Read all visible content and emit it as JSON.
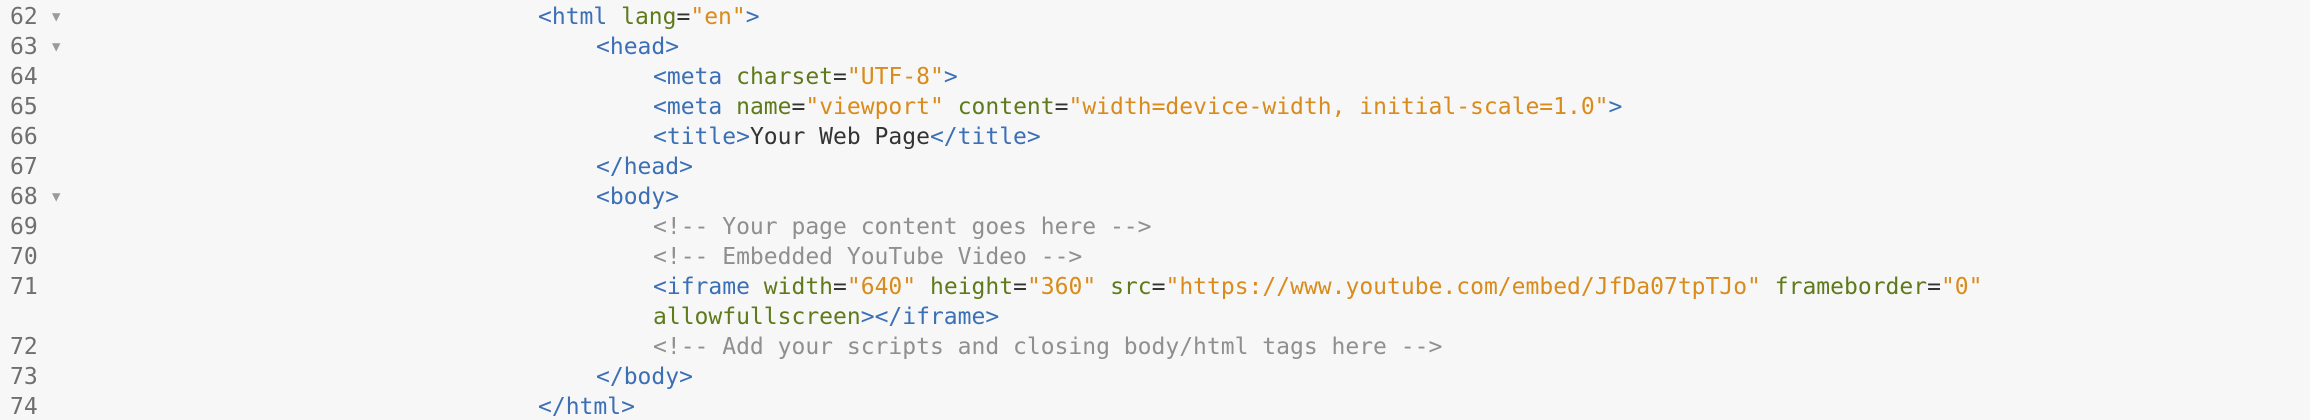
{
  "editor": {
    "lines": [
      {
        "number": "62",
        "fold": "▼",
        "tokens": [
          {
            "text": "<html ",
            "type": "tag"
          },
          {
            "text": "lang",
            "type": "attr"
          },
          {
            "text": "=",
            "type": "txt"
          },
          {
            "text": "\"en\"",
            "type": "str"
          },
          {
            "text": ">",
            "type": "tag"
          }
        ]
      },
      {
        "number": "63",
        "fold": "▼",
        "tokens": [
          {
            "text": "<head>",
            "type": "tag"
          }
        ]
      },
      {
        "number": "64",
        "fold": "",
        "tokens": [
          {
            "text": "<meta ",
            "type": "tag"
          },
          {
            "text": "charset",
            "type": "attr"
          },
          {
            "text": "=",
            "type": "txt"
          },
          {
            "text": "\"UTF-8\"",
            "type": "str"
          },
          {
            "text": ">",
            "type": "tag"
          }
        ]
      },
      {
        "number": "65",
        "fold": "",
        "tokens": [
          {
            "text": "<meta ",
            "type": "tag"
          },
          {
            "text": "name",
            "type": "attr"
          },
          {
            "text": "=",
            "type": "txt"
          },
          {
            "text": "\"viewport\"",
            "type": "str"
          },
          {
            "text": " ",
            "type": "txt"
          },
          {
            "text": "content",
            "type": "attr"
          },
          {
            "text": "=",
            "type": "txt"
          },
          {
            "text": "\"width=device-width, initial-scale=1.0\"",
            "type": "str"
          },
          {
            "text": ">",
            "type": "tag"
          }
        ]
      },
      {
        "number": "66",
        "fold": "",
        "tokens": [
          {
            "text": "<title>",
            "type": "tag"
          },
          {
            "text": "Your Web Page",
            "type": "txt"
          },
          {
            "text": "</title>",
            "type": "tag"
          }
        ]
      },
      {
        "number": "67",
        "fold": "",
        "tokens": [
          {
            "text": "</head>",
            "type": "tag"
          }
        ]
      },
      {
        "number": "68",
        "fold": "▼",
        "tokens": [
          {
            "text": "<body>",
            "type": "tag"
          }
        ]
      },
      {
        "number": "69",
        "fold": "",
        "tokens": [
          {
            "text": "<!-- Your page content goes here -->",
            "type": "com"
          }
        ]
      },
      {
        "number": "70",
        "fold": "",
        "tokens": [
          {
            "text": "<!-- Embedded YouTube Video -->",
            "type": "com"
          }
        ]
      },
      {
        "number": "71",
        "fold": "",
        "tokens": [
          {
            "text": "<iframe ",
            "type": "tag"
          },
          {
            "text": "width",
            "type": "attr"
          },
          {
            "text": "=",
            "type": "txt"
          },
          {
            "text": "\"640\"",
            "type": "str"
          },
          {
            "text": " ",
            "type": "txt"
          },
          {
            "text": "height",
            "type": "attr"
          },
          {
            "text": "=",
            "type": "txt"
          },
          {
            "text": "\"360\"",
            "type": "str"
          },
          {
            "text": " ",
            "type": "txt"
          },
          {
            "text": "src",
            "type": "attr"
          },
          {
            "text": "=",
            "type": "txt"
          },
          {
            "text": "\"https://www.youtube.com/embed/JfDa07tpTJo\"",
            "type": "str"
          },
          {
            "text": " ",
            "type": "txt"
          },
          {
            "text": "frameborder",
            "type": "attr"
          },
          {
            "text": "=",
            "type": "txt"
          },
          {
            "text": "\"0\"",
            "type": "str"
          }
        ]
      },
      {
        "number": "",
        "fold": "",
        "tokens": [
          {
            "text": "allowfullscreen",
            "type": "attr"
          },
          {
            "text": "></iframe>",
            "type": "tag"
          }
        ]
      },
      {
        "number": "72",
        "fold": "",
        "tokens": [
          {
            "text": "<!-- Add your scripts and closing body/html tags here -->",
            "type": "com"
          }
        ]
      },
      {
        "number": "73",
        "fold": "",
        "tokens": [
          {
            "text": "</body>",
            "type": "tag"
          }
        ]
      },
      {
        "number": "74",
        "fold": "",
        "tokens": [
          {
            "text": "</html>",
            "type": "tag"
          }
        ]
      }
    ]
  }
}
